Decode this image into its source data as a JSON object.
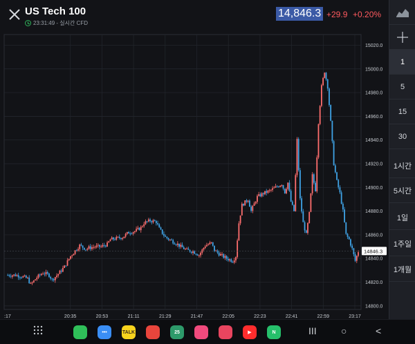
{
  "header": {
    "title": "US Tech 100",
    "subtitle": "23:31:49 - 실시간 CFD",
    "price": "14,846.3",
    "change": "+29.9",
    "change_pct": "+0.20%",
    "up_color": "#ff5a5f"
  },
  "sidebar": {
    "items": [
      {
        "label": "",
        "icon": "area-chart-icon"
      },
      {
        "label": "",
        "icon": "crosshair-icon"
      },
      {
        "label": "1"
      },
      {
        "label": "5"
      },
      {
        "label": "15"
      },
      {
        "label": "30"
      },
      {
        "label": "1시간"
      },
      {
        "label": "5시간"
      },
      {
        "label": "1일"
      },
      {
        "label": "1주일"
      },
      {
        "label": "1개월"
      }
    ],
    "active_index": 2
  },
  "chart_data": {
    "type": "candlestick",
    "y_ticks": [
      15020.0,
      15000.0,
      14980.0,
      14960.0,
      14940.0,
      14920.0,
      14900.0,
      14880.0,
      14860.0,
      14840.0,
      14820.0,
      14800.0
    ],
    "y_tick_labels": [
      "15020.0",
      "15000.0",
      "14980.0",
      "14960.0",
      "14940.0",
      "14920.0",
      "14900.0",
      "14880.0",
      "14860.0",
      "14840.0",
      "14820.0",
      "14800.0"
    ],
    "ylim": [
      14797,
      15029
    ],
    "x_tick_labels": [
      ":17",
      "20:35",
      "20:53",
      "21:11",
      "21:29",
      "21:47",
      "22:05",
      "22:23",
      "22:41",
      "22:59",
      "23:17"
    ],
    "last_price_label": "14846.3",
    "up_color": "#ff6e6e",
    "down_color": "#3fa3e6",
    "grid": true,
    "close_path": [
      [
        0,
        14826
      ],
      [
        6,
        14826
      ],
      [
        10,
        14825
      ],
      [
        14,
        14823
      ],
      [
        16,
        14818
      ],
      [
        20,
        14824
      ],
      [
        24,
        14828
      ],
      [
        28,
        14826
      ],
      [
        30,
        14822
      ],
      [
        34,
        14827
      ],
      [
        38,
        14833
      ],
      [
        42,
        14842
      ],
      [
        46,
        14848
      ],
      [
        48,
        14851
      ],
      [
        52,
        14848
      ],
      [
        54,
        14849
      ],
      [
        58,
        14850
      ],
      [
        62,
        14850
      ],
      [
        66,
        14852
      ],
      [
        68,
        14856
      ],
      [
        72,
        14857
      ],
      [
        76,
        14858
      ],
      [
        80,
        14862
      ],
      [
        84,
        14863
      ],
      [
        88,
        14866
      ],
      [
        90,
        14870
      ],
      [
        94,
        14872
      ],
      [
        98,
        14871
      ],
      [
        100,
        14865
      ],
      [
        104,
        14858
      ],
      [
        108,
        14855
      ],
      [
        112,
        14852
      ],
      [
        114,
        14850
      ],
      [
        118,
        14847
      ],
      [
        122,
        14846
      ],
      [
        126,
        14843
      ],
      [
        130,
        14851
      ],
      [
        134,
        14853
      ],
      [
        136,
        14847
      ],
      [
        140,
        14843
      ],
      [
        144,
        14840
      ],
      [
        148,
        14838
      ],
      [
        150,
        14842
      ],
      [
        152,
        14870
      ],
      [
        154,
        14885
      ],
      [
        158,
        14890
      ],
      [
        160,
        14880
      ],
      [
        164,
        14892
      ],
      [
        168,
        14895
      ],
      [
        172,
        14897
      ],
      [
        176,
        14900
      ],
      [
        180,
        14903
      ],
      [
        182,
        14896
      ],
      [
        184,
        14904
      ],
      [
        186,
        14888
      ],
      [
        188,
        14880
      ],
      [
        190,
        14940
      ],
      [
        192,
        14890
      ],
      [
        194,
        14870
      ],
      [
        196,
        14860
      ],
      [
        198,
        14878
      ],
      [
        200,
        14910
      ],
      [
        202,
        14898
      ],
      [
        204,
        14955
      ],
      [
        206,
        14985
      ],
      [
        208,
        14998
      ],
      [
        210,
        14985
      ],
      [
        212,
        14955
      ],
      [
        214,
        14920
      ],
      [
        216,
        14905
      ],
      [
        218,
        14895
      ],
      [
        220,
        14880
      ],
      [
        222,
        14860
      ],
      [
        224,
        14856
      ],
      [
        226,
        14848
      ],
      [
        228,
        14838
      ],
      [
        230,
        14846
      ]
    ]
  },
  "navbar": {
    "apps": [
      {
        "name": "phone-app-icon",
        "label": "",
        "color": "#2fbf59"
      },
      {
        "name": "messages-app-icon",
        "label": "•••",
        "color": "#3a8ef5"
      },
      {
        "name": "kakaotalk-app-icon",
        "label": "TALK",
        "color": "#f7d31d"
      },
      {
        "name": "chrome-app-icon",
        "label": "",
        "color": "#e8453c"
      },
      {
        "name": "calendar-app-icon",
        "label": "25",
        "color": "#2d9a6a"
      },
      {
        "name": "flower-app-icon",
        "label": "",
        "color": "#f04a7d"
      },
      {
        "name": "camera-app-icon",
        "label": "",
        "color": "#e8455f"
      },
      {
        "name": "youtube-app-icon",
        "label": "▶",
        "color": "#ff2d2d"
      },
      {
        "name": "naver-app-icon",
        "label": "N",
        "color": "#26c06b"
      }
    ],
    "recents_label": "III",
    "home_label": "○",
    "back_label": "<"
  }
}
